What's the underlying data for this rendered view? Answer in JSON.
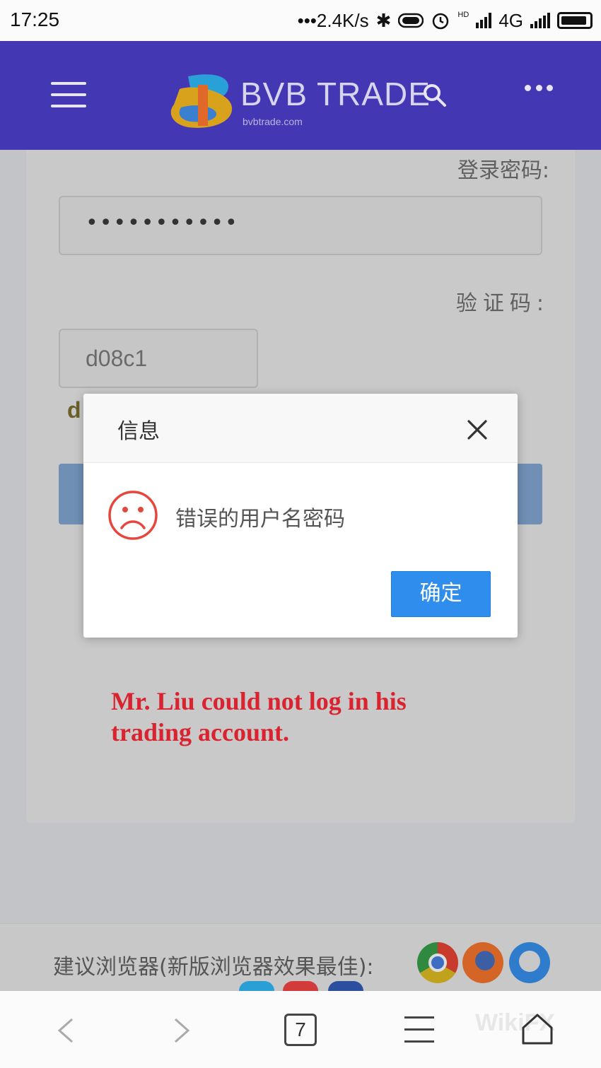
{
  "status_bar": {
    "time": "17:25",
    "network_speed": "•••2.4K/s",
    "network_type": "4G",
    "hd_badge": "HD"
  },
  "header": {
    "brand": "BVB TRADE",
    "domain": "bvbtrade.com",
    "icons": [
      "menu-icon",
      "search-icon",
      "more-icon"
    ]
  },
  "login_form": {
    "password_label": "登录密码:",
    "password_value": "•••••••••••",
    "captcha_label": "验证码:",
    "captcha_value": "d08c1",
    "captcha_hint": "d"
  },
  "dialog": {
    "title": "信息",
    "message": "错误的用户名密码",
    "confirm_label": "确定"
  },
  "annotation": {
    "line1": "Mr. Liu could not log in his",
    "line2": "trading account."
  },
  "browser_suggest": {
    "text": "建议浏览器(新版浏览器效果最佳):"
  },
  "nav_bar": {
    "tab_count": "7",
    "watermark": "WikiFX"
  },
  "colors": {
    "header_bg": "#4437b3",
    "confirm_button": "#2e8ded",
    "annotation_text": "#d9232e",
    "sad_icon": "#e5473f"
  }
}
